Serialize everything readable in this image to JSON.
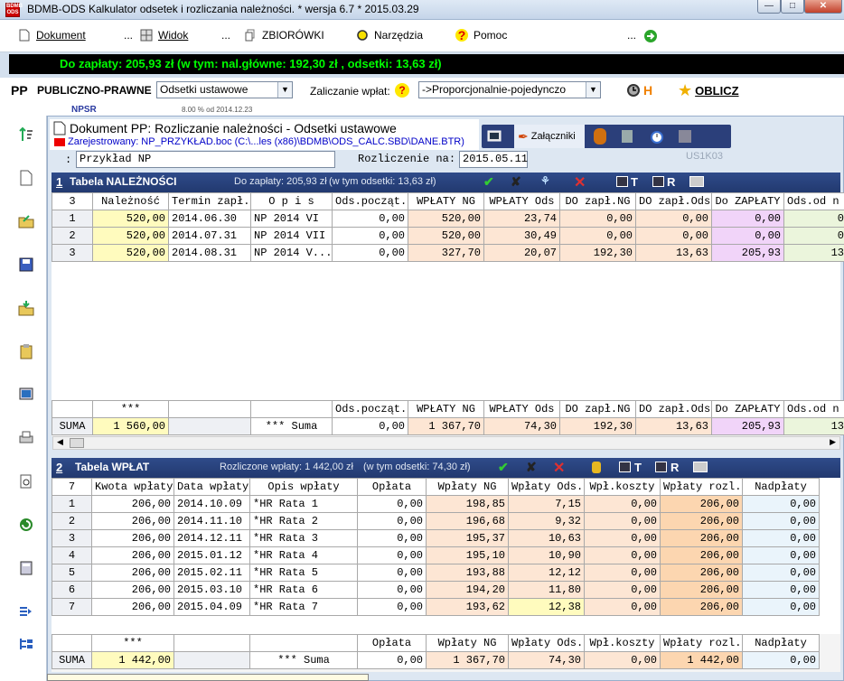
{
  "window": {
    "title": "BDMB-ODS Kalkulator odsetek i rozliczania należności.  * wersja 6.7 * 2015.03.29"
  },
  "menu": {
    "dokument": "Dokument",
    "sep1": "...",
    "widok": "Widok",
    "sep2": "...",
    "zbiorowki": "ZBIORÓWKI",
    "narzedzia": "Narzędzia",
    "pomoc": "Pomoc",
    "sep3": "..."
  },
  "status": {
    "text": "Do zapłaty: 205,93 zł   (w tym:  nal.główne: 192,30 zł ,  odsetki: 13,63 zł)"
  },
  "pp": {
    "label": "PP",
    "type": "PUBLICZNO-PRAWNE",
    "odsetki_select": "Odsetki ustawowe",
    "zaliczanie_label": "Zaliczanie wpłat:",
    "zaliczanie_select": "->Proporcjonalnie-pojedynczo",
    "h_label": "H",
    "oblicz_label": "OBLICZ",
    "npsr": "NPSR",
    "rate": "8.00 % od 2014.12.23"
  },
  "document": {
    "title": "Dokument PP: Rozliczanie należności - Odsetki ustawowe",
    "registered": "Zarejestrowany: NP_PRZYKŁAD.boc (C:\\...les (x86)\\BDMB\\ODS_CALC.SBD\\DANE.BTR)",
    "attachments": "Załączniki",
    "name_prefix": ":",
    "name_value": "Przykład NP",
    "rozliczenie_label": "Rozliczenie na:",
    "rozliczenie_value": "2015.05.11",
    "code": "US1K03"
  },
  "table1": {
    "num": "1",
    "title": "Tabela NALEŻNOŚCI",
    "info1": "Do zapłaty: 205,93 zł",
    "info2": "(w tym odsetki: 13,63 zł)",
    "t_label": "T",
    "r_label": "R",
    "headers": [
      "3",
      "Należność",
      "Termin zapł.",
      "O p i s",
      "Ods.począt.",
      "WPŁATY NG",
      "WPŁATY Ods",
      "DO zapł.NG",
      "DO zapł.Ods",
      "Do ZAPŁATY",
      "Ods.od n"
    ],
    "rows": [
      [
        "1",
        "520,00",
        "2014.06.30",
        "NP 2014 VI",
        "0,00",
        "520,00",
        "23,74",
        "0,00",
        "0,00",
        "0,00",
        "0"
      ],
      [
        "2",
        "520,00",
        "2014.07.31",
        "NP 2014 VII",
        "0,00",
        "520,00",
        "30,49",
        "0,00",
        "0,00",
        "0,00",
        "0"
      ],
      [
        "3",
        "520,00",
        "2014.08.31",
        "NP 2014 V...",
        "0,00",
        "327,70",
        "20,07",
        "192,30",
        "13,63",
        "205,93",
        "13"
      ]
    ],
    "sum_headers": [
      "",
      "***",
      "",
      "",
      "Ods.począt.",
      "WPŁATY NG",
      "WPŁATY Ods",
      "DO zapł.NG",
      "DO zapł.Ods",
      "Do ZAPŁATY",
      "Ods.od n"
    ],
    "sum_row": [
      "SUMA",
      "1 560,00",
      "",
      "*** Suma",
      "0,00",
      "1 367,70",
      "74,30",
      "192,30",
      "13,63",
      "205,93",
      "13"
    ]
  },
  "table2": {
    "num": "2",
    "title": "Tabela WPŁAT",
    "info1": "Rozliczone wpłaty: 1 442,00 zł",
    "info2": "(w tym odsetki: 74,30 zł)",
    "t_label": "T",
    "r_label": "R",
    "headers": [
      "7",
      "Kwota wpłaty",
      "Data wpłaty",
      "Opis wpłaty",
      "Opłata",
      "Wpłaty  NG",
      "Wpłaty Ods.",
      "Wpł.koszty",
      "Wpłaty rozl.",
      "Nadpłaty"
    ],
    "rows": [
      [
        "1",
        "206,00",
        "2014.10.09",
        "*HR Rata 1",
        "0,00",
        "198,85",
        "7,15",
        "0,00",
        "206,00",
        "0,00"
      ],
      [
        "2",
        "206,00",
        "2014.11.10",
        "*HR Rata 2",
        "0,00",
        "196,68",
        "9,32",
        "0,00",
        "206,00",
        "0,00"
      ],
      [
        "3",
        "206,00",
        "2014.12.11",
        "*HR Rata 3",
        "0,00",
        "195,37",
        "10,63",
        "0,00",
        "206,00",
        "0,00"
      ],
      [
        "4",
        "206,00",
        "2015.01.12",
        "*HR Rata 4",
        "0,00",
        "195,10",
        "10,90",
        "0,00",
        "206,00",
        "0,00"
      ],
      [
        "5",
        "206,00",
        "2015.02.11",
        "*HR Rata 5",
        "0,00",
        "193,88",
        "12,12",
        "0,00",
        "206,00",
        "0,00"
      ],
      [
        "6",
        "206,00",
        "2015.03.10",
        "*HR Rata 6",
        "0,00",
        "194,20",
        "11,80",
        "0,00",
        "206,00",
        "0,00"
      ],
      [
        "7",
        "206,00",
        "2015.04.09",
        "*HR Rata 7",
        "0,00",
        "193,62",
        "12,38",
        "0,00",
        "206,00",
        "0,00"
      ]
    ],
    "sum_headers": [
      "",
      "***",
      "",
      "",
      "Opłata",
      "Wpłaty  NG",
      "Wpłaty Ods.",
      "Wpł.koszty",
      "Wpłaty rozl.",
      "Nadpłaty"
    ],
    "sum_row": [
      "SUMA",
      "1 442,00",
      "",
      "*** Suma",
      "0,00",
      "1 367,70",
      "74,30",
      "0,00",
      "1 442,00",
      "0,00"
    ]
  },
  "colors": {
    "status_bg": "#000000",
    "status_fg": "#00ff00",
    "header_blue": "#2b4580",
    "cell_yellow": "#fffbbe",
    "cell_peach": "#fde6d4",
    "cell_orange": "#fcd6b0",
    "cell_violet": "#f1d4f9",
    "cell_green": "#ebf5dc"
  }
}
